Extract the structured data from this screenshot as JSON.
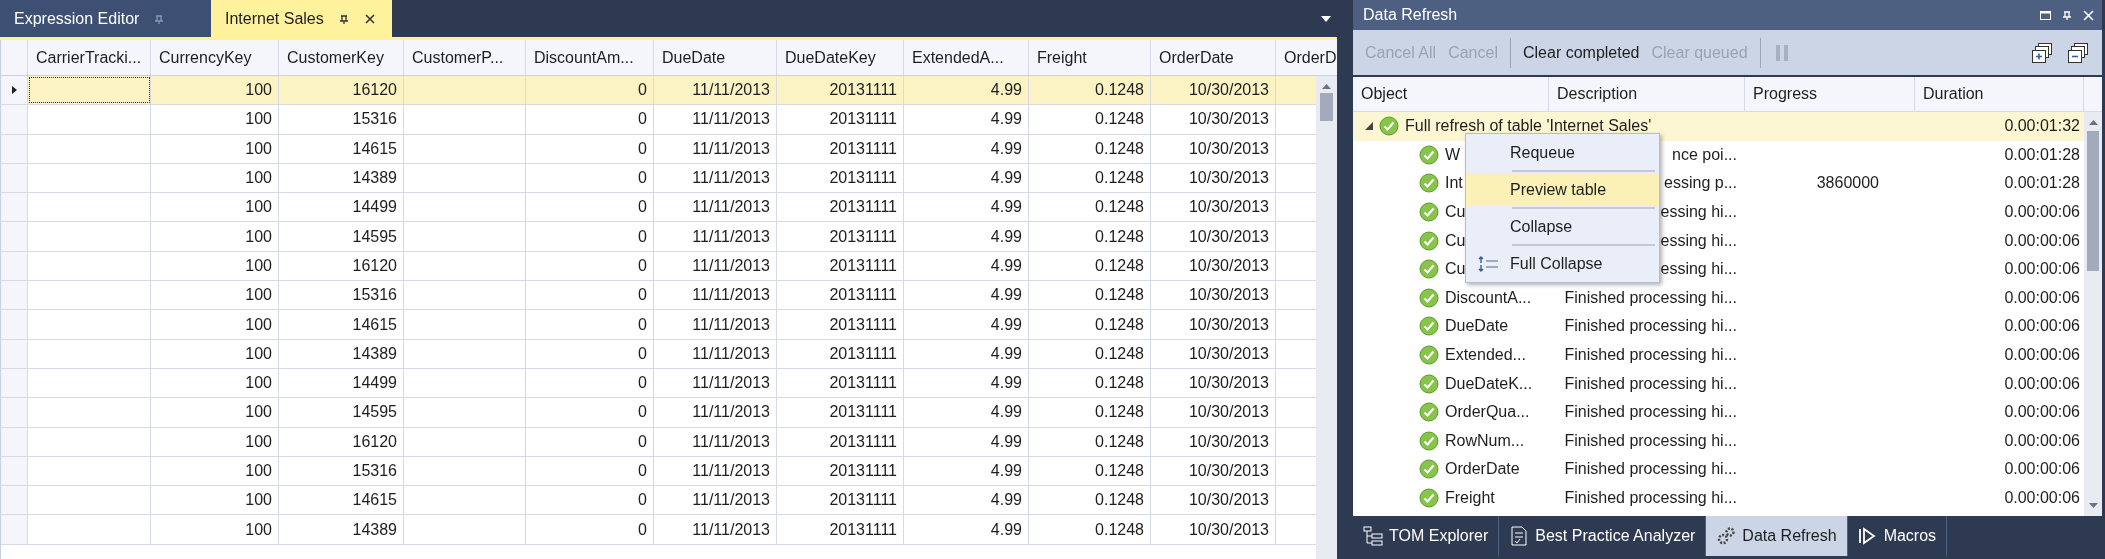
{
  "document_tabs": [
    {
      "label": "Expression Editor",
      "selected": false
    },
    {
      "label": "Internet Sales",
      "selected": true
    }
  ],
  "grid": {
    "columns": [
      "CarrierTracki...",
      "CurrencyKey",
      "CustomerKey",
      "CustomerP...",
      "DiscountAm...",
      "DueDate",
      "DueDateKey",
      "ExtendedA...",
      "Freight",
      "OrderDate",
      "OrderD"
    ],
    "rows": [
      {
        "selected": true,
        "cells": [
          null,
          "100",
          "16120",
          null,
          "0",
          "11/11/2013",
          "20131111",
          "4.99",
          "0.1248",
          "10/30/2013",
          null
        ]
      },
      {
        "selected": false,
        "cells": [
          null,
          "100",
          "15316",
          null,
          "0",
          "11/11/2013",
          "20131111",
          "4.99",
          "0.1248",
          "10/30/2013",
          null
        ]
      },
      {
        "selected": false,
        "cells": [
          null,
          "100",
          "14615",
          null,
          "0",
          "11/11/2013",
          "20131111",
          "4.99",
          "0.1248",
          "10/30/2013",
          null
        ]
      },
      {
        "selected": false,
        "cells": [
          null,
          "100",
          "14389",
          null,
          "0",
          "11/11/2013",
          "20131111",
          "4.99",
          "0.1248",
          "10/30/2013",
          null
        ]
      },
      {
        "selected": false,
        "cells": [
          null,
          "100",
          "14499",
          null,
          "0",
          "11/11/2013",
          "20131111",
          "4.99",
          "0.1248",
          "10/30/2013",
          null
        ]
      },
      {
        "selected": false,
        "cells": [
          null,
          "100",
          "14595",
          null,
          "0",
          "11/11/2013",
          "20131111",
          "4.99",
          "0.1248",
          "10/30/2013",
          null
        ]
      },
      {
        "selected": false,
        "cells": [
          null,
          "100",
          "16120",
          null,
          "0",
          "11/11/2013",
          "20131111",
          "4.99",
          "0.1248",
          "10/30/2013",
          null
        ]
      },
      {
        "selected": false,
        "cells": [
          null,
          "100",
          "15316",
          null,
          "0",
          "11/11/2013",
          "20131111",
          "4.99",
          "0.1248",
          "10/30/2013",
          null
        ]
      },
      {
        "selected": false,
        "cells": [
          null,
          "100",
          "14615",
          null,
          "0",
          "11/11/2013",
          "20131111",
          "4.99",
          "0.1248",
          "10/30/2013",
          null
        ]
      },
      {
        "selected": false,
        "cells": [
          null,
          "100",
          "14389",
          null,
          "0",
          "11/11/2013",
          "20131111",
          "4.99",
          "0.1248",
          "10/30/2013",
          null
        ]
      },
      {
        "selected": false,
        "cells": [
          null,
          "100",
          "14499",
          null,
          "0",
          "11/11/2013",
          "20131111",
          "4.99",
          "0.1248",
          "10/30/2013",
          null
        ]
      },
      {
        "selected": false,
        "cells": [
          null,
          "100",
          "14595",
          null,
          "0",
          "11/11/2013",
          "20131111",
          "4.99",
          "0.1248",
          "10/30/2013",
          null
        ]
      },
      {
        "selected": false,
        "cells": [
          null,
          "100",
          "16120",
          null,
          "0",
          "11/11/2013",
          "20131111",
          "4.99",
          "0.1248",
          "10/30/2013",
          null
        ]
      },
      {
        "selected": false,
        "cells": [
          null,
          "100",
          "15316",
          null,
          "0",
          "11/11/2013",
          "20131111",
          "4.99",
          "0.1248",
          "10/30/2013",
          null
        ]
      },
      {
        "selected": false,
        "cells": [
          null,
          "100",
          "14615",
          null,
          "0",
          "11/11/2013",
          "20131111",
          "4.99",
          "0.1248",
          "10/30/2013",
          null
        ]
      },
      {
        "selected": false,
        "cells": [
          null,
          "100",
          "14389",
          null,
          "0",
          "11/11/2013",
          "20131111",
          "4.99",
          "0.1248",
          "10/30/2013",
          null
        ]
      }
    ]
  },
  "refresh_panel": {
    "title": "Data Refresh",
    "toolbar": [
      {
        "kind": "button",
        "label": "Cancel All",
        "disabled": true
      },
      {
        "kind": "button",
        "label": "Cancel",
        "disabled": true
      },
      {
        "kind": "separator"
      },
      {
        "kind": "button",
        "label": "Clear completed",
        "disabled": false
      },
      {
        "kind": "button",
        "label": "Clear queued",
        "disabled": true
      },
      {
        "kind": "separator"
      },
      {
        "kind": "pause",
        "disabled": true
      },
      {
        "kind": "expand"
      },
      {
        "kind": "collapse"
      }
    ],
    "columns": [
      "Object",
      "Description",
      "Progress",
      "Duration"
    ],
    "tree": [
      {
        "object": "Full refresh of table 'Internet Sales'",
        "duration": "0.00:01:32",
        "expanded": true,
        "selected": true,
        "children": [
          {
            "object": "W",
            "description": "nce poi...",
            "duration": "0.00:01:28",
            "selected": false
          },
          {
            "object": "Int",
            "description": "essing p...",
            "progress": "3860000",
            "duration": "0.00:01:28",
            "selected": false
          },
          {
            "object": "Cu",
            "description": "essing hi...",
            "duration": "0.00:00:06",
            "selected": false
          },
          {
            "object": "Cu",
            "description": "essing hi...",
            "duration": "0.00:00:06",
            "selected": false
          },
          {
            "object": "Cu",
            "description": "essing hi...",
            "duration": "0.00:00:06",
            "selected": false
          },
          {
            "object": "DiscountA...",
            "description": "Finished processing hi...",
            "duration": "0.00:00:06",
            "selected": false
          },
          {
            "object": "DueDate",
            "description": "Finished processing hi...",
            "duration": "0.00:00:06",
            "selected": false
          },
          {
            "object": "Extended...",
            "description": "Finished processing hi...",
            "duration": "0.00:00:06",
            "selected": false
          },
          {
            "object": "DueDateK...",
            "description": "Finished processing hi...",
            "duration": "0.00:00:06",
            "selected": false
          },
          {
            "object": "OrderQua...",
            "description": "Finished processing hi...",
            "duration": "0.00:00:06",
            "selected": false
          },
          {
            "object": "RowNum...",
            "description": "Finished processing hi...",
            "duration": "0.00:00:06",
            "selected": false
          },
          {
            "object": "OrderDate",
            "description": "Finished processing hi...",
            "duration": "0.00:00:06",
            "selected": false
          },
          {
            "object": "Freight",
            "description": "Finished processing hi...",
            "duration": "0.00:00:06",
            "selected": false
          }
        ]
      }
    ],
    "context_menu": [
      {
        "kind": "plain",
        "label": "Requeue",
        "selected": false
      },
      {
        "kind": "plain",
        "label": "Preview table",
        "selected": true
      },
      {
        "kind": "plain",
        "label": "Collapse",
        "selected": false
      },
      {
        "kind": "iconed",
        "label": "Full Collapse",
        "selected": false
      }
    ]
  },
  "tool_tabs": [
    {
      "kind": "tree",
      "label": "TOM Explorer",
      "selected": false
    },
    {
      "kind": "checklist",
      "label": "Best Practice Analyzer",
      "selected": false
    },
    {
      "kind": "gears",
      "label": "Data Refresh",
      "selected": true
    },
    {
      "kind": "macro",
      "label": "Macros",
      "selected": false
    }
  ]
}
